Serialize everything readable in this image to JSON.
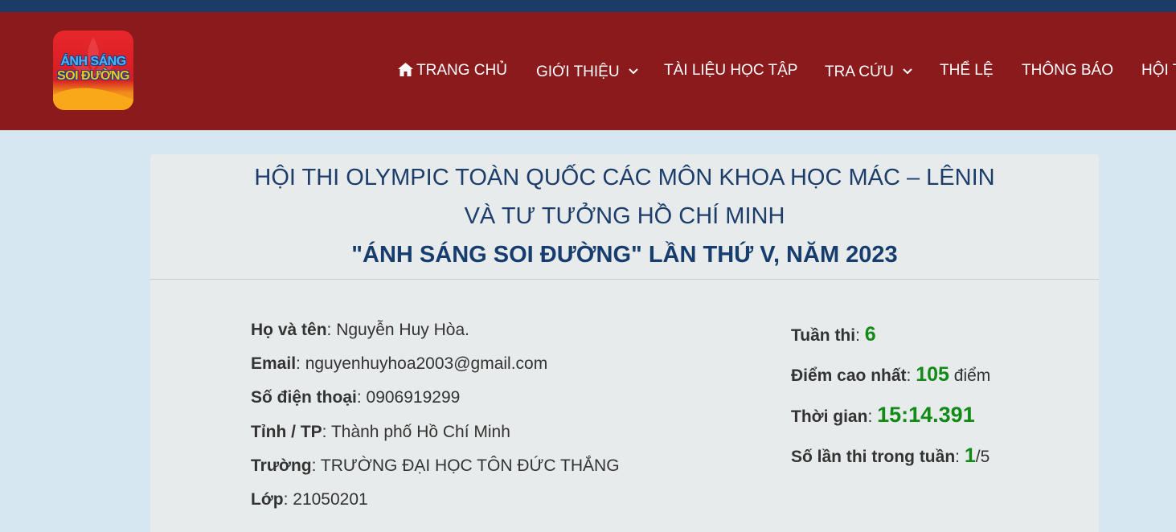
{
  "colors": {
    "top_bar": "#1a3c66",
    "header": "#8a1a1c",
    "page_background": "#d6e7f1",
    "card_background": "#e8ebeb",
    "title": "#1d3e6b",
    "highlight_value": "#108b15"
  },
  "logo": {
    "line1": "ÁNH SÁNG",
    "line2": "SOI ĐƯỜNG"
  },
  "nav": {
    "items": [
      {
        "label": "TRANG CHỦ",
        "icon": "home-icon",
        "dropdown": false
      },
      {
        "label": "GIỚI THIỆU",
        "icon": "chevron-down-icon",
        "dropdown": true
      },
      {
        "label": "TÀI LIỆU HỌC TẬP",
        "dropdown": false
      },
      {
        "label": "TRA CỨU",
        "icon": "chevron-down-icon",
        "dropdown": true
      },
      {
        "label": "THỂ LỆ",
        "dropdown": false
      },
      {
        "label": "THÔNG BÁO",
        "dropdown": false
      },
      {
        "label": "HỘI THI",
        "dropdown": false
      }
    ]
  },
  "heading": {
    "line1": "HỘI THI OLYMPIC TOÀN QUỐC CÁC MÔN KHOA HỌC MÁC – LÊNIN",
    "line2": "VÀ TƯ TƯỞNG HỒ CHÍ MINH",
    "line3": "\"ÁNH SÁNG SOI ĐƯỜNG\" LẦN THỨ V, NĂM 2023"
  },
  "profile": {
    "name_label": "Họ và tên",
    "name_value": ": Nguyễn Huy Hòa.",
    "email_label": "Email",
    "email_value": ": nguyenhuyhoa2003@gmail.com",
    "phone_label": "Số điện thoại",
    "phone_value": ": 0906919299",
    "province_label": "Tỉnh / TP",
    "province_value": ": Thành phố Hồ Chí Minh",
    "school_label": "Trường",
    "school_value": ": TRƯỜNG ĐẠI HỌC TÔN ĐỨC THẮNG",
    "class_label": "Lớp",
    "class_value": ": 21050201"
  },
  "results": {
    "week_label": "Tuần thi",
    "week_value": "6",
    "score_label": "Điểm cao nhất",
    "score_value": "105",
    "score_unit": "điểm",
    "time_label": "Thời gian",
    "time_value": "15:14.391",
    "attempts_label": "Số lần thi trong tuần",
    "attempts_value": "1",
    "attempts_total": "/5",
    "separator": ": "
  }
}
